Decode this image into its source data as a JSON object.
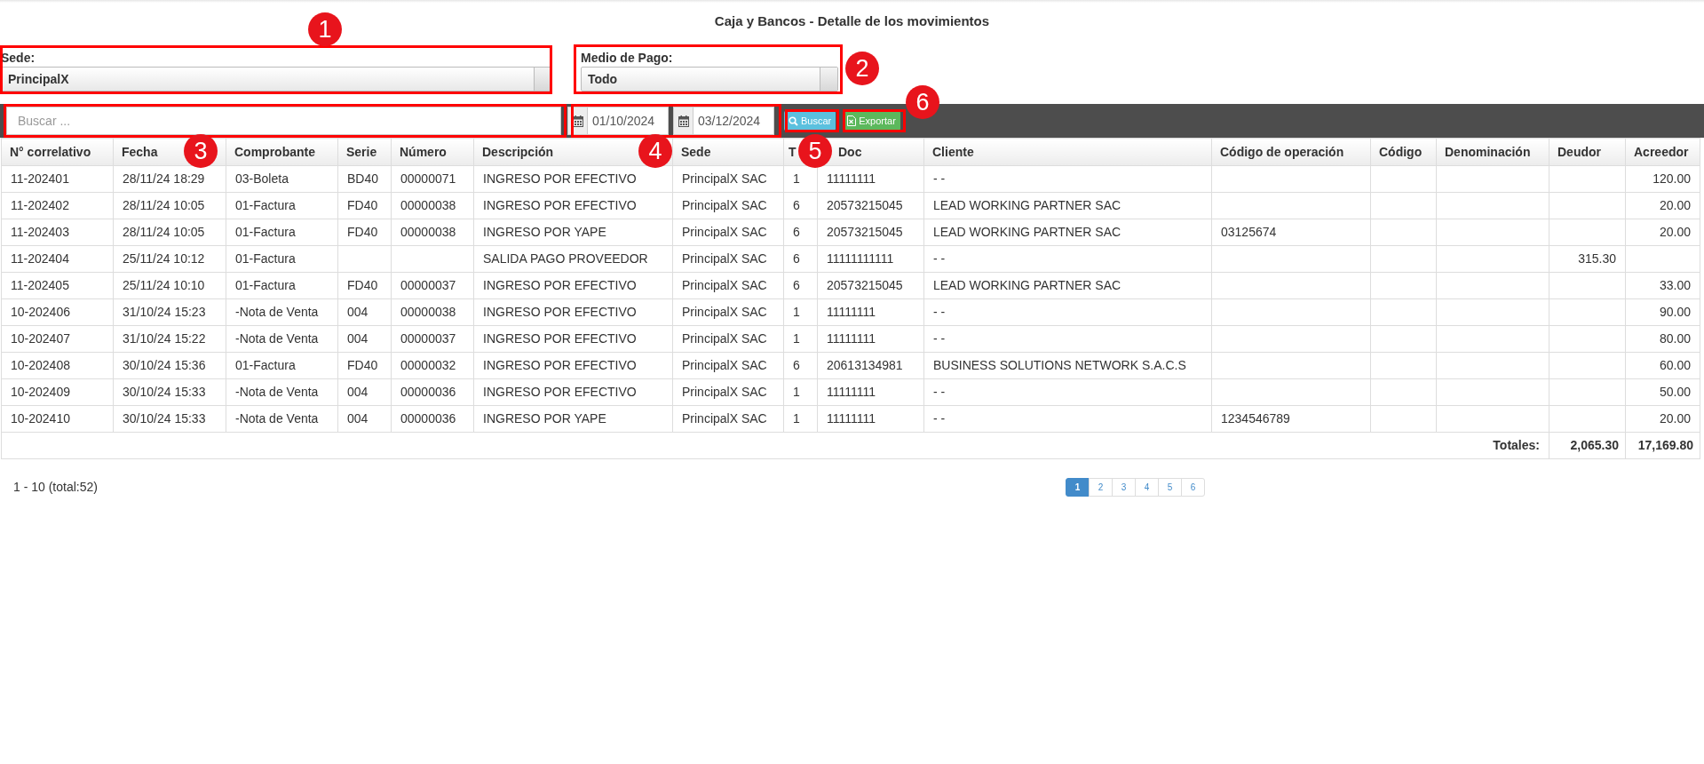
{
  "title": "Caja y Bancos - Detalle de los movimientos",
  "filters": {
    "sede": {
      "label": "Sede:",
      "value": "PrincipalX"
    },
    "medio_pago": {
      "label": "Medio de Pago:",
      "value": "Todo"
    }
  },
  "search": {
    "placeholder": "Buscar ..."
  },
  "dates": [
    "01/10/2024",
    "03/12/2024"
  ],
  "buttons": [
    {
      "kind": "search",
      "label": "Buscar"
    },
    {
      "kind": "export",
      "label": "Exportar"
    }
  ],
  "table": {
    "columns": [
      "N° correlativo",
      "Fecha",
      "Comprobante",
      "Serie",
      "Número",
      "Descripción",
      "Sede",
      "T",
      "Doc",
      "Cliente",
      "Código de operación",
      "Código",
      "Denominación",
      "Deudor",
      "Acreedor"
    ],
    "rows": [
      [
        "11-202401",
        "28/11/24 18:29",
        "03-Boleta",
        "BD40",
        "00000071",
        "INGRESO POR EFECTIVO",
        "PrincipalX SAC",
        "1",
        "11111111",
        "- -",
        null,
        null,
        null,
        null,
        "120.00"
      ],
      [
        "11-202402",
        "28/11/24 10:05",
        "01-Factura",
        "FD40",
        "00000038",
        "INGRESO POR EFECTIVO",
        "PrincipalX SAC",
        "6",
        "20573215045",
        "LEAD WORKING PARTNER SAC",
        null,
        null,
        null,
        null,
        "20.00"
      ],
      [
        "11-202403",
        "28/11/24 10:05",
        "01-Factura",
        "FD40",
        "00000038",
        "INGRESO POR YAPE",
        "PrincipalX SAC",
        "6",
        "20573215045",
        "LEAD WORKING PARTNER SAC",
        "03125674",
        null,
        null,
        null,
        "20.00"
      ],
      [
        "11-202404",
        "25/11/24 10:12",
        "01-Factura",
        null,
        null,
        "SALIDA PAGO PROVEEDOR",
        "PrincipalX SAC",
        "6",
        "11111111111",
        "- -",
        null,
        null,
        null,
        "315.30",
        null
      ],
      [
        "11-202405",
        "25/11/24 10:10",
        "01-Factura",
        "FD40",
        "00000037",
        "INGRESO POR EFECTIVO",
        "PrincipalX SAC",
        "6",
        "20573215045",
        "LEAD WORKING PARTNER SAC",
        null,
        null,
        null,
        null,
        "33.00"
      ],
      [
        "10-202406",
        "31/10/24 15:23",
        "-Nota de Venta",
        "004",
        "00000038",
        "INGRESO POR EFECTIVO",
        "PrincipalX SAC",
        "1",
        "11111111",
        "- -",
        null,
        null,
        null,
        null,
        "90.00"
      ],
      [
        "10-202407",
        "31/10/24 15:22",
        "-Nota de Venta",
        "004",
        "00000037",
        "INGRESO POR EFECTIVO",
        "PrincipalX SAC",
        "1",
        "11111111",
        "- -",
        null,
        null,
        null,
        null,
        "80.00"
      ],
      [
        "10-202408",
        "30/10/24 15:36",
        "01-Factura",
        "FD40",
        "00000032",
        "INGRESO POR EFECTIVO",
        "PrincipalX SAC",
        "6",
        "20613134981",
        "BUSINESS SOLUTIONS NETWORK S.A.C.S",
        null,
        null,
        null,
        null,
        "60.00"
      ],
      [
        "10-202409",
        "30/10/24 15:33",
        "-Nota de Venta",
        "004",
        "00000036",
        "INGRESO POR EFECTIVO",
        "PrincipalX SAC",
        "1",
        "11111111",
        "- -",
        null,
        null,
        null,
        null,
        "50.00"
      ],
      [
        "10-202410",
        "30/10/24 15:33",
        "-Nota de Venta",
        "004",
        "00000036",
        "INGRESO POR YAPE",
        "PrincipalX SAC",
        "1",
        "11111111",
        "- -",
        "1234546789",
        null,
        null,
        null,
        "20.00"
      ]
    ],
    "totals": {
      "label": "Totales:",
      "deudor": "2,065.30",
      "acreedor": "17,169.80"
    }
  },
  "footer": {
    "range": "1 - 10 (total:52)"
  },
  "pagination": [
    {
      "label": "1",
      "selected": true
    },
    {
      "label": "2",
      "selected": false
    },
    {
      "label": "3",
      "selected": false
    },
    {
      "label": "4",
      "selected": false
    },
    {
      "label": "5",
      "selected": false
    },
    {
      "label": "6",
      "selected": false
    }
  ],
  "annotations": [
    "1",
    "2",
    "3",
    "4",
    "5",
    "6"
  ]
}
